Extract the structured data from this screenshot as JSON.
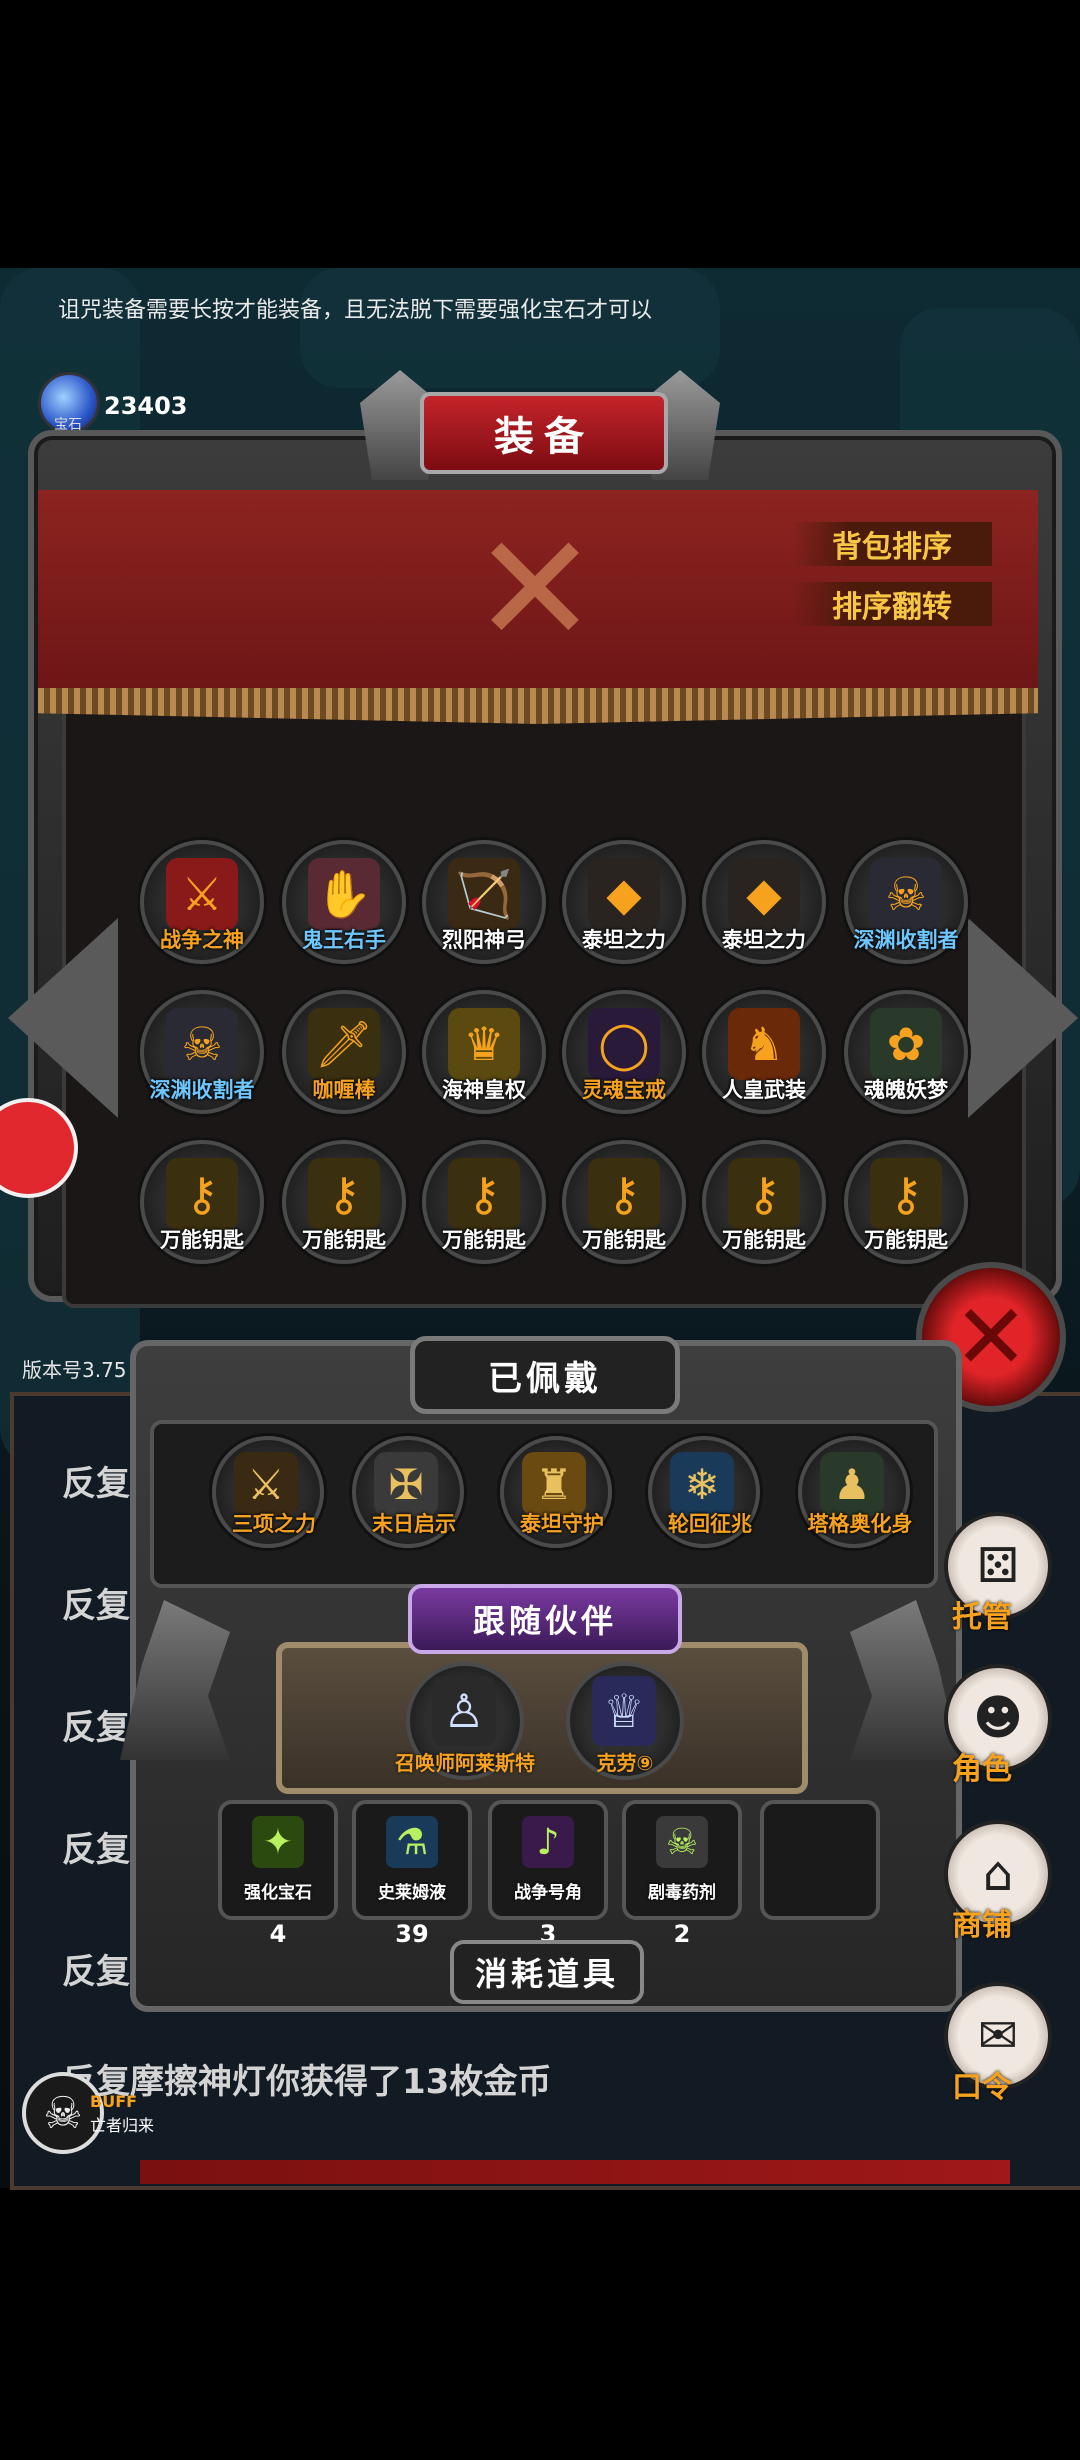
{
  "notice": "诅咒装备需要长按才能装备，且无法脱下需要强化宝石才可以",
  "currency": {
    "label": "宝石",
    "value": "23403",
    "icon": "blue-gem-icon"
  },
  "panel": {
    "title": "装备",
    "sort_button": "背包排序",
    "reverse_button": "排序翻转"
  },
  "equipment": [
    {
      "name": "战争之神",
      "color": "orange",
      "icon": "war-god-icon",
      "glyph": "⚔",
      "tint": "#8a1a1a"
    },
    {
      "name": "鬼王右手",
      "color": "blue",
      "icon": "ghost-king-hand-icon",
      "glyph": "✋",
      "tint": "#5a2a34"
    },
    {
      "name": "烈阳神弓",
      "color": "white",
      "icon": "bow-icon",
      "glyph": "🏹",
      "tint": "#3a2a14"
    },
    {
      "name": "泰坦之力",
      "color": "white",
      "icon": "titan-rune-icon",
      "glyph": "◆",
      "tint": "#2a2420"
    },
    {
      "name": "泰坦之力",
      "color": "white",
      "icon": "titan-rune-icon",
      "glyph": "◆",
      "tint": "#2a2420"
    },
    {
      "name": "深渊收割者",
      "color": "blue",
      "icon": "reaper-icon",
      "glyph": "☠",
      "tint": "#2a2a34"
    },
    {
      "name": "深渊收割者",
      "color": "blue",
      "icon": "reaper-icon",
      "glyph": "☠",
      "tint": "#2a2a34"
    },
    {
      "name": "咖喱棒",
      "color": "orange",
      "icon": "sword-icon",
      "glyph": "🗡",
      "tint": "#3a3010"
    },
    {
      "name": "海神皇权",
      "color": "white",
      "icon": "golden-armor-icon",
      "glyph": "♛",
      "tint": "#5a4a10"
    },
    {
      "name": "灵魂宝戒",
      "color": "orange",
      "icon": "ring-icon",
      "glyph": "◯",
      "tint": "#2a1a3a"
    },
    {
      "name": "人皇武装",
      "color": "white",
      "icon": "knight-icon",
      "glyph": "♞",
      "tint": "#6a2a0a"
    },
    {
      "name": "魂魄妖梦",
      "color": "white",
      "icon": "spirit-icon",
      "glyph": "✿",
      "tint": "#2a3a2a"
    },
    {
      "name": "万能钥匙",
      "color": "white",
      "icon": "key-icon",
      "glyph": "⚷",
      "tint": "#3a3010"
    },
    {
      "name": "万能钥匙",
      "color": "white",
      "icon": "key-icon",
      "glyph": "⚷",
      "tint": "#3a3010"
    },
    {
      "name": "万能钥匙",
      "color": "white",
      "icon": "key-icon",
      "glyph": "⚷",
      "tint": "#3a3010"
    },
    {
      "name": "万能钥匙",
      "color": "white",
      "icon": "key-icon",
      "glyph": "⚷",
      "tint": "#3a3010"
    },
    {
      "name": "万能钥匙",
      "color": "white",
      "icon": "key-icon",
      "glyph": "⚷",
      "tint": "#3a3010"
    },
    {
      "name": "万能钥匙",
      "color": "white",
      "icon": "key-icon",
      "glyph": "⚷",
      "tint": "#3a3010"
    }
  ],
  "version": "版本号3.75",
  "worn": {
    "title": "已佩戴",
    "items": [
      {
        "name": "三项之力",
        "icon": "trinity-icon",
        "glyph": "⚔",
        "tint": "#3a2a14"
      },
      {
        "name": "末日启示",
        "icon": "axe-icon",
        "glyph": "✠",
        "tint": "#3a3a3a"
      },
      {
        "name": "泰坦守护",
        "icon": "titan-armor-icon",
        "glyph": "♜",
        "tint": "#6a4a10"
      },
      {
        "name": "轮回征兆",
        "icon": "ice-staff-icon",
        "glyph": "❄",
        "tint": "#1a3a5a"
      },
      {
        "name": "塔格奥化身",
        "icon": "beast-icon",
        "glyph": "♟",
        "tint": "#2a3a2a"
      }
    ]
  },
  "partners": {
    "title": "跟随伙伴",
    "items": [
      {
        "name": "召唤师阿莱斯特",
        "icon": "summoner-icon",
        "glyph": "♙",
        "tint": "#2a2a2a"
      },
      {
        "name": "克劳⑨",
        "icon": "blue-hair-girl-icon",
        "glyph": "♕",
        "tint": "#2a2a5a"
      }
    ]
  },
  "consumables": {
    "title": "消耗道具",
    "items": [
      {
        "name": "强化宝石",
        "count": "4",
        "icon": "green-gem-icon",
        "glyph": "✦",
        "tint": "#2a4a10"
      },
      {
        "name": "史莱姆液",
        "count": "39",
        "icon": "potion-icon",
        "glyph": "⚗",
        "tint": "#1a3a5a"
      },
      {
        "name": "战争号角",
        "count": "3",
        "icon": "horn-icon",
        "glyph": "♪",
        "tint": "#3a1a4a"
      },
      {
        "name": "剧毒药剂",
        "count": "2",
        "icon": "poison-icon",
        "glyph": "☠",
        "tint": "#3a3a3a"
      }
    ]
  },
  "log": {
    "lines": [
      "反复",
      "反复",
      "反复",
      "反复",
      "反复"
    ],
    "last": "反复摩擦神灯你获得了13枚金币"
  },
  "side_menu": [
    {
      "label": "托管",
      "icon": "dice-icon",
      "glyph": "⚄"
    },
    {
      "label": "角色",
      "icon": "hooded-figure-icon",
      "glyph": "☻"
    },
    {
      "label": "商铺",
      "icon": "shop-icon",
      "glyph": "⌂"
    },
    {
      "label": "口令",
      "icon": "scroll-icon",
      "glyph": "✉"
    }
  ],
  "buff": {
    "label": "BUFF",
    "name": "亡者归来",
    "icon": "skull-icon"
  },
  "colors": {
    "orange": "#f6a21e",
    "blue": "#6ec7ff",
    "banner_red": "#8c2420"
  }
}
